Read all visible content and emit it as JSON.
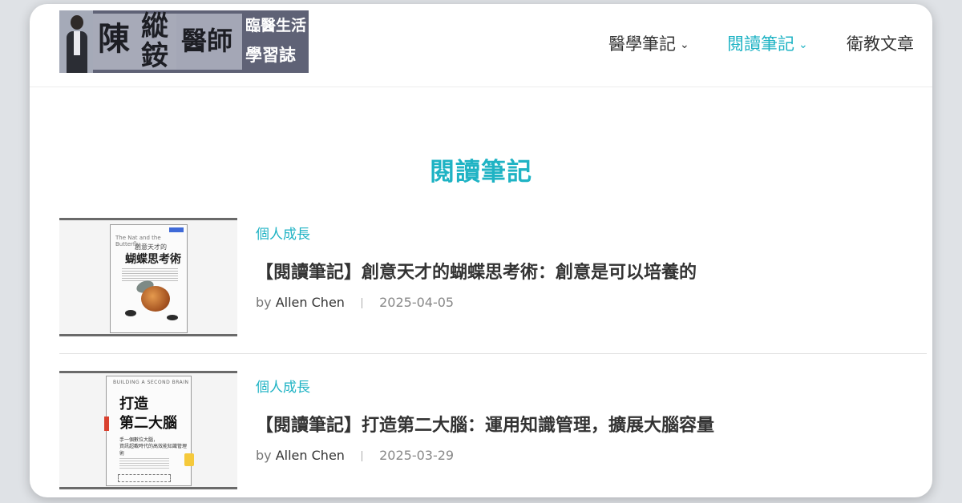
{
  "logo": {
    "name_main": "陳",
    "name_side": "縱銨",
    "doctor": "醫師",
    "tagline_1": "臨醫生活",
    "tagline_2": "學習誌"
  },
  "nav": {
    "items": [
      {
        "label": "醫學筆記",
        "has_dropdown": true,
        "active": false
      },
      {
        "label": "閱讀筆記",
        "has_dropdown": true,
        "active": true
      },
      {
        "label": "衛教文章",
        "has_dropdown": false,
        "active": false
      }
    ],
    "chevron": "⌄"
  },
  "page": {
    "title": "閱讀筆記"
  },
  "colors": {
    "accent": "#1fb3c4",
    "text": "#333333",
    "meta": "#777777",
    "background": "#dfe2e6"
  },
  "posts": [
    {
      "category": "個人成長",
      "title": "【閱讀筆記】創意天才的蝴蝶思考術：創意是可以培養的",
      "by": "by",
      "author": "Allen Chen",
      "date": "2025-04-05",
      "book": {
        "en_title": "The Nat and the Butterfly",
        "subtitle": "創意天才的",
        "title": "蝴蝶思考術"
      }
    },
    {
      "category": "個人成長",
      "title": "【閱讀筆記】打造第二大腦：運用知識管理，擴展大腦容量",
      "by": "by",
      "author": "Allen Chen",
      "date": "2025-03-29",
      "book": {
        "en_title": "BUILDING A SECOND BRAIN",
        "title_1": "打造",
        "title_2": "第二大腦",
        "subtitle_1": "手一個數位大腦，",
        "subtitle_2": "資訊超載時代的高效能知識管理術"
      }
    }
  ]
}
